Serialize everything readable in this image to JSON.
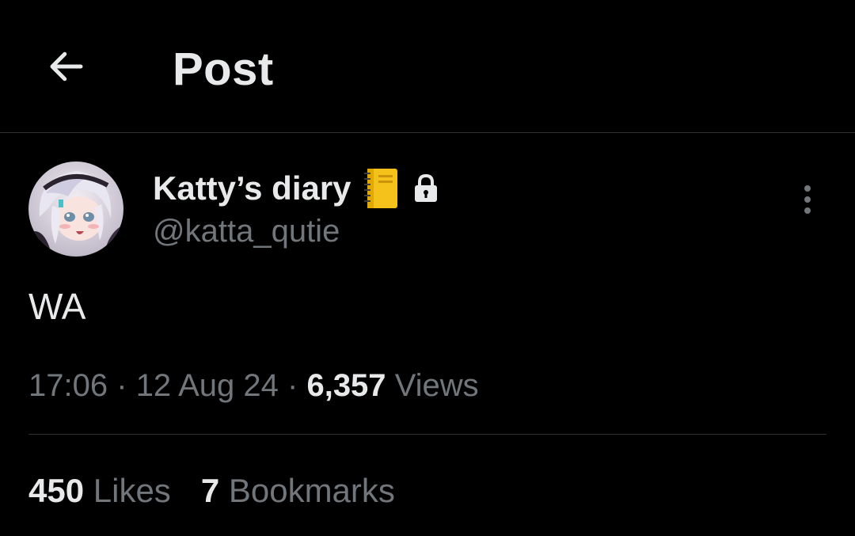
{
  "header": {
    "back_icon": "arrow-left-icon",
    "title": "Post"
  },
  "post": {
    "author": {
      "display_name": "Katty’s diary",
      "badges": [
        "notebook-emoji-icon",
        "lock-icon"
      ],
      "handle": "@katta_qutie",
      "avatar": "anime-girl-avatar"
    },
    "more_icon": "more-vertical-icon",
    "text": "WA",
    "time": "17:06",
    "separator": "·",
    "date": "12 Aug 24",
    "views_count": "6,357",
    "views_label": "Views"
  },
  "stats": {
    "likes_count": "450",
    "likes_label": "Likes",
    "bookmarks_count": "7",
    "bookmarks_label": "Bookmarks"
  },
  "colors": {
    "background": "#000000",
    "primary_text": "#e7e9ea",
    "secondary_text": "#71767b",
    "divider": "#2f3336"
  }
}
